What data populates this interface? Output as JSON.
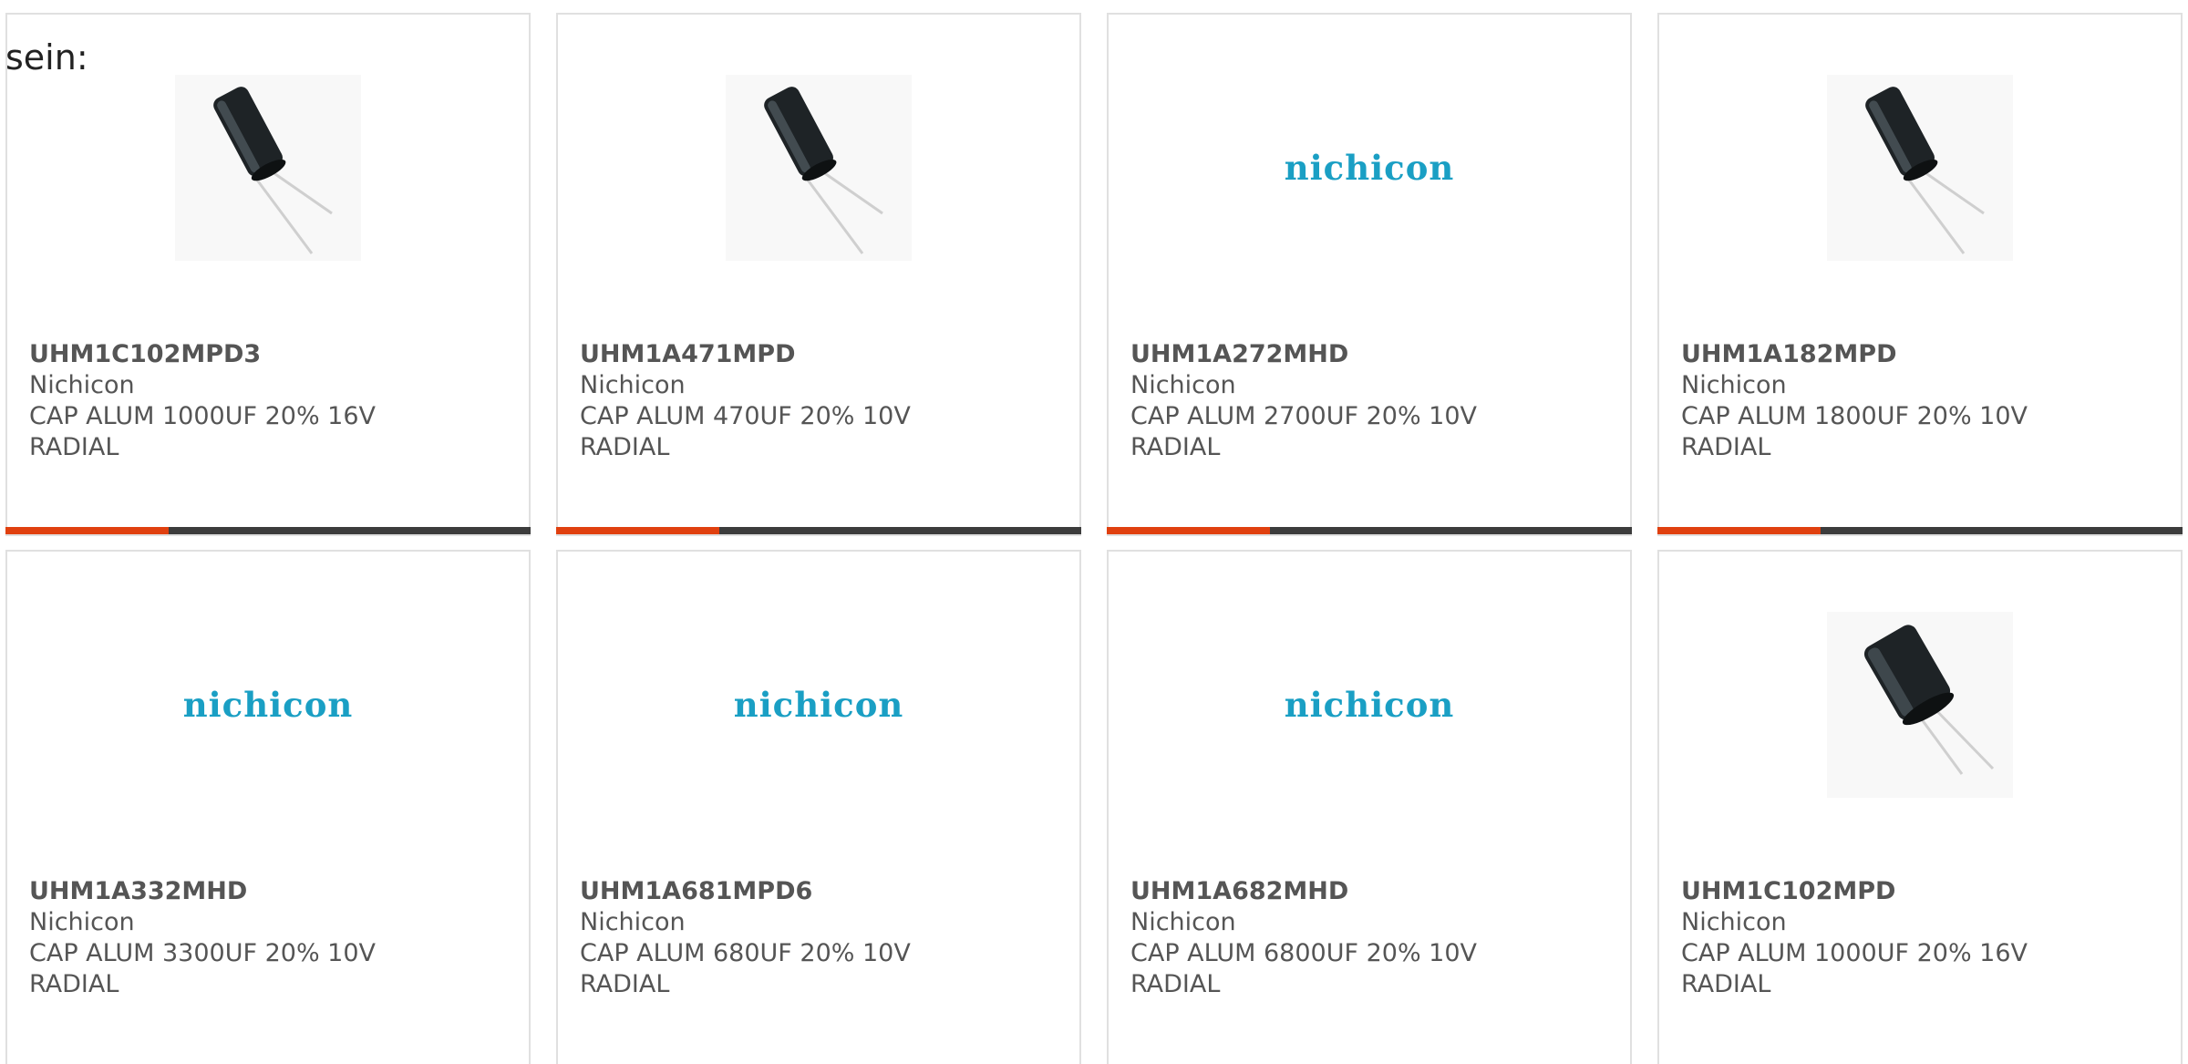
{
  "intro_text": "sein:",
  "colors": {
    "progress_active": "#e0400f",
    "progress_track": "#3c3c3c",
    "logo_blue": "#1a9fc4",
    "card_border": "#e0e0e0"
  },
  "cards": [
    {
      "part_number": "UHM1C102MPD3",
      "manufacturer": "Nichicon",
      "description_line1": "CAP ALUM 1000UF 20% 16V",
      "description_line2": "RADIAL",
      "image": "capacitor-photo",
      "progress_fraction": 0.31
    },
    {
      "part_number": "UHM1A471MPD",
      "manufacturer": "Nichicon",
      "description_line1": "CAP ALUM 470UF 20% 10V",
      "description_line2": "RADIAL",
      "image": "capacitor-photo",
      "progress_fraction": 0.31
    },
    {
      "part_number": "UHM1A272MHD",
      "manufacturer": "Nichicon",
      "description_line1": "CAP ALUM 2700UF 20% 10V",
      "description_line2": "RADIAL",
      "image": "manufacturer-logo",
      "logo_text": "nichicon",
      "progress_fraction": 0.31
    },
    {
      "part_number": "UHM1A182MPD",
      "manufacturer": "Nichicon",
      "description_line1": "CAP ALUM 1800UF 20% 10V",
      "description_line2": "RADIAL",
      "image": "capacitor-photo",
      "progress_fraction": 0.31
    },
    {
      "part_number": "UHM1A332MHD",
      "manufacturer": "Nichicon",
      "description_line1": "CAP ALUM 3300UF 20% 10V",
      "description_line2": "RADIAL",
      "image": "manufacturer-logo",
      "logo_text": "nichicon",
      "progress_fraction": null
    },
    {
      "part_number": "UHM1A681MPD6",
      "manufacturer": "Nichicon",
      "description_line1": "CAP ALUM 680UF 20% 10V",
      "description_line2": "RADIAL",
      "image": "manufacturer-logo",
      "logo_text": "nichicon",
      "progress_fraction": null
    },
    {
      "part_number": "UHM1A682MHD",
      "manufacturer": "Nichicon",
      "description_line1": "CAP ALUM 6800UF 20% 10V",
      "description_line2": "RADIAL",
      "image": "manufacturer-logo",
      "logo_text": "nichicon",
      "progress_fraction": null
    },
    {
      "part_number": "UHM1C102MPD",
      "manufacturer": "Nichicon",
      "description_line1": "CAP ALUM 1000UF 20% 16V",
      "description_line2": "RADIAL",
      "image": "capacitor-photo",
      "progress_fraction": null
    }
  ]
}
